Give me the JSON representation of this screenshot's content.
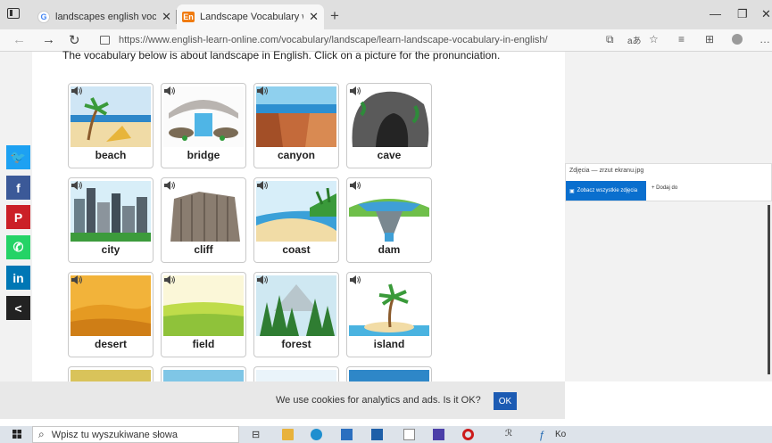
{
  "browser": {
    "tabs": [
      {
        "title": "landscapes english vocabulary -",
        "favicon": "google-g-icon"
      },
      {
        "title": "Landscape Vocabulary with Flash",
        "favicon": "english-learn-online-icon"
      }
    ],
    "url": "https://www.english-learn-online.com/vocabulary/landscape/learn-landscape-vocabulary-in-english/",
    "reader_text": "aあ"
  },
  "page": {
    "intro": "The vocabulary below is about landscape in English. Click on a picture for the pronunciation.",
    "cards": [
      {
        "label": "beach",
        "scene": "beach"
      },
      {
        "label": "bridge",
        "scene": "bridge"
      },
      {
        "label": "canyon",
        "scene": "canyon"
      },
      {
        "label": "cave",
        "scene": "cave"
      },
      {
        "label": "city",
        "scene": "city"
      },
      {
        "label": "cliff",
        "scene": "cliff"
      },
      {
        "label": "coast",
        "scene": "coast"
      },
      {
        "label": "dam",
        "scene": "dam"
      },
      {
        "label": "desert",
        "scene": "desert"
      },
      {
        "label": "field",
        "scene": "field"
      },
      {
        "label": "forest",
        "scene": "forest"
      },
      {
        "label": "island",
        "scene": "island"
      }
    ]
  },
  "social": [
    {
      "name": "twitter",
      "glyph": "🐦",
      "color": "#1da1f2"
    },
    {
      "name": "facebook",
      "glyph": "f",
      "color": "#3b5998"
    },
    {
      "name": "pinterest",
      "glyph": "P",
      "color": "#cb2027"
    },
    {
      "name": "whatsapp",
      "glyph": "✆",
      "color": "#25d366"
    },
    {
      "name": "linkedin",
      "glyph": "in",
      "color": "#0077b5"
    },
    {
      "name": "share",
      "glyph": "<",
      "color": "#222222"
    }
  ],
  "photos_popup": {
    "title": "Zdjęcia — zrzut ekranu.jpg",
    "view_all": "Zobacz wszystkie zdjęcia",
    "add_to": "+  Dodaj do"
  },
  "cookie": {
    "text": "We use cookies for analytics and ads. Is it OK?",
    "ok": "OK"
  },
  "taskbar": {
    "search_placeholder": "Wpisz tu wyszukiwane słowa",
    "partial_label": "Ko"
  }
}
